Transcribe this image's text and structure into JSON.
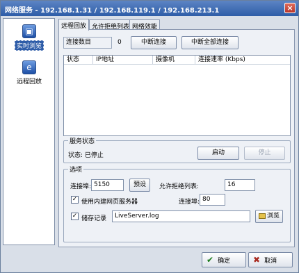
{
  "window": {
    "title": "网络服务 - 192.168.1.31 / 192.168.119.1 / 192.168.213.1",
    "close_glyph": "×"
  },
  "sidebar": {
    "items": [
      {
        "label": "实时浏览",
        "icon": "monitor-icon",
        "active": true
      },
      {
        "label": "远程回放",
        "icon": "ie-icon",
        "active": false
      }
    ]
  },
  "tabs": [
    "远程回放",
    "允许拒绝列表",
    "网络效能"
  ],
  "connections": {
    "count_label": "连接数目",
    "count_value": "0",
    "disconnect_label": "中断连接",
    "disconnect_all_label": "中断全部连接",
    "columns": [
      "状态",
      "IP地址",
      "摄像机",
      "连接速率 (Kbps)"
    ],
    "rows": []
  },
  "service_status": {
    "group_label": "服务状态",
    "status_text": "状态: 已停止",
    "start_label": "启动",
    "stop_label": "停止"
  },
  "options": {
    "group_label": "选项",
    "port_label": "连接埠:",
    "port_value": "5150",
    "preset_label": "预设",
    "allow_list_label": "允许拒绝列表:",
    "allow_list_value": "16",
    "webserver_label": "使用内建网页服务器",
    "webserver_checked": true,
    "web_port_label": "连接埠:",
    "web_port_value": "80",
    "log_label": "储存记录",
    "log_checked": true,
    "log_file": "LiveServer.log",
    "browse_label": "浏览"
  },
  "dialog": {
    "ok_label": "确定",
    "cancel_label": "取消",
    "check_glyph": "✓",
    "ok_glyph": "✔",
    "cancel_glyph": "✖"
  },
  "colors": {
    "titlebar": "#2f5ea8",
    "window_bg": "#d9dfe8",
    "panel_bg": "#eef1f6"
  }
}
